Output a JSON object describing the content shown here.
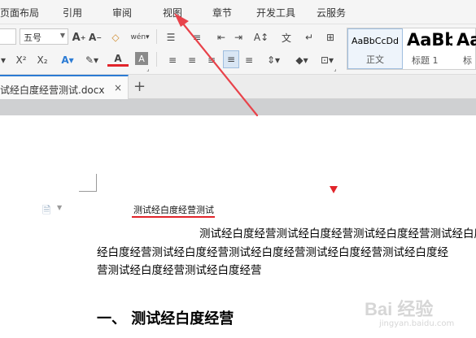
{
  "menu_tabs": [
    "页面布局",
    "引用",
    "审阅",
    "视图",
    "章节",
    "开发工具",
    "云服务"
  ],
  "ribbon": {
    "font_size_value": "五号",
    "style_gallery": [
      {
        "preview": "AaBbCcDd",
        "name": "正文"
      },
      {
        "preview": "AaBb",
        "name": "标题 1"
      },
      {
        "preview": "Aa",
        "name": "标"
      }
    ]
  },
  "doc_tab": {
    "label": "试经白度经营测试.docx",
    "close": "×",
    "new_tab": "+"
  },
  "document": {
    "title": "测试经白度经营测试",
    "paragraph_lines": [
      "测试经白度经营测试经白度经营测试经白度经营测试经白度",
      "经白度经营测试经白度经营测试经白度经营测试经白度经营测试经白度经",
      "营测试经白度经营测试经白度经营"
    ],
    "heading": "一、 测试经白度经营"
  },
  "watermark": {
    "logo": "Bai 经验",
    "sub": "jingyan.baidu.com"
  },
  "colors": {
    "arrow": "#e8424a",
    "title_underline": "#e1242a",
    "accent": "#2b7bd4"
  }
}
